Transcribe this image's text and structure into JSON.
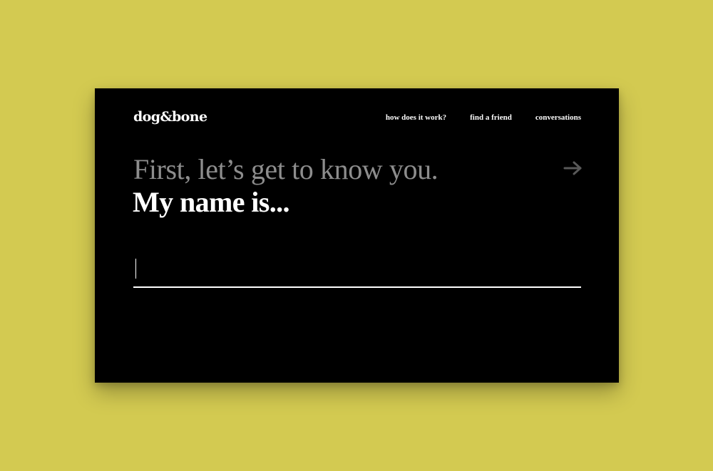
{
  "brand": {
    "logo_text": "dog&bone"
  },
  "nav": {
    "items": [
      {
        "label": "how does it work?"
      },
      {
        "label": "find a friend"
      },
      {
        "label": "conversations"
      }
    ]
  },
  "intro": {
    "prompt": "First, let’s get to know you.",
    "question": "My name is..."
  },
  "form": {
    "name_value": "",
    "name_placeholder": ""
  },
  "icons": {
    "next": "arrow-right-icon"
  },
  "colors": {
    "background": "#d3ca51",
    "panel": "#000000",
    "text_primary": "#ffffff",
    "text_muted": "#8d8d8d",
    "arrow": "#595959"
  }
}
